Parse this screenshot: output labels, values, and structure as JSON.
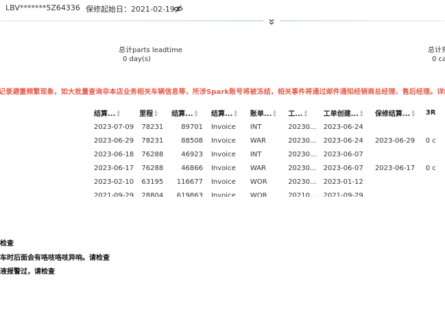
{
  "header": {
    "vin": "LBV*******5Z64336",
    "warranty_start": "保修起始日：2021-02-19",
    "eye_icon": "eye-off-icon"
  },
  "stats": [
    {
      "label": "总计parts leadtime",
      "value": "0 day(s)"
    },
    {
      "label": "总计充",
      "value": "0 ca"
    }
  ],
  "notice": "记录避重频繁现象，如大批量查询非本店业务相关车辆信息等，所涉Spark账号将被冻结，相关事件将通过邮件通知经销商总经理、售后经理。详经",
  "table": {
    "columns": [
      "结算...",
      "里程",
      "结算...",
      "结算...",
      "账单...",
      "工...",
      "工单创建...",
      "保修结算...",
      "3R"
    ],
    "rows": [
      [
        "2023-07-09",
        "78231",
        "89701",
        "Invoice",
        "INT",
        "20230...",
        "2023-06-24",
        "",
        ""
      ],
      [
        "2023-06-29",
        "78231",
        "88508",
        "Invoice",
        "WAR",
        "20230...",
        "2023-06-24",
        "2023-06-29",
        "0 c"
      ],
      [
        "2023-06-18",
        "76288",
        "46923",
        "Invoice",
        "INT",
        "20230...",
        "2023-06-07",
        "",
        ""
      ],
      [
        "2023-06-17",
        "76288",
        "46866",
        "Invoice",
        "WAR",
        "20230...",
        "2023-06-07",
        "2023-06-17",
        "0 c"
      ],
      [
        "2023-02-10",
        "63195",
        "116677",
        "Invoice",
        "WOR",
        "20230...",
        "2023-01-12",
        "",
        ""
      ],
      [
        "2021-09-29",
        "28804",
        "619863",
        "Invoice",
        "WOR",
        "20210...",
        "2021-09-29",
        "",
        ""
      ]
    ]
  },
  "notes": [
    "检查",
    "车时后面会有咯吱咯吱异响。请检查",
    "液报警过，请检查"
  ]
}
